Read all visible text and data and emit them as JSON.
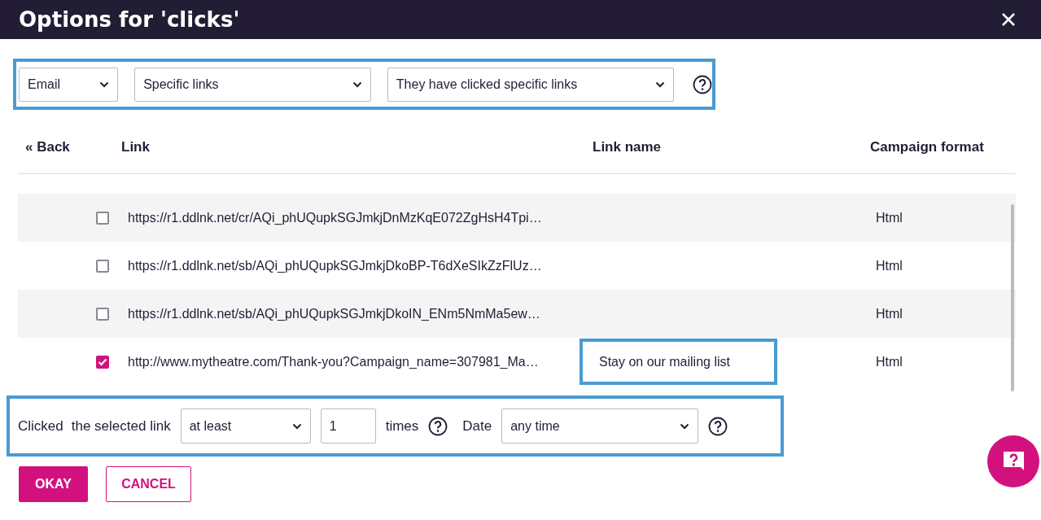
{
  "dialog": {
    "title": "Options for 'clicks'"
  },
  "filters": {
    "selects": [
      {
        "value": "Email"
      },
      {
        "value": "Specific links"
      },
      {
        "value": "They have clicked specific links"
      }
    ]
  },
  "table": {
    "back": "« Back",
    "columns": [
      "Link",
      "Link name",
      "Campaign format"
    ],
    "rows": [
      {
        "url": "https://r1.ddlnk.net/cr/AQi_phUQupkSGJmkjDnMzKqE072ZgHsH4Tpi…",
        "name": "",
        "format": "Html",
        "checked": false
      },
      {
        "url": "https://r1.ddlnk.net/sb/AQi_phUQupkSGJmkjDkoBP-T6dXeSIkZzFlUz…",
        "name": "",
        "format": "Html",
        "checked": false
      },
      {
        "url": "https://r1.ddlnk.net/sb/AQi_phUQupkSGJmkjDkoIN_ENm5NmMa5ew…",
        "name": "",
        "format": "Html",
        "checked": false
      },
      {
        "url": "http://www.mytheatre.com/Thank-you?Campaign_name=307981_Ma…",
        "name": "Stay on our mailing list",
        "format": "Html",
        "checked": true
      }
    ]
  },
  "condition": {
    "label": "Clicked",
    "target": "the selected link",
    "operator": "at least",
    "count": "1",
    "unit": "times",
    "date_label": "Date",
    "date": "any time"
  },
  "buttons": {
    "ok": "OKAY",
    "cancel": "CANCEL"
  }
}
